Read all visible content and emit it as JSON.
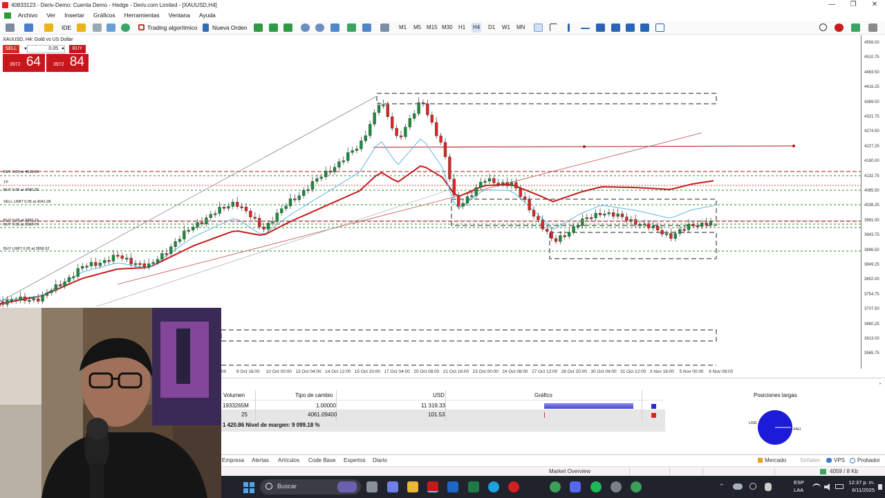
{
  "window": {
    "title": "40833123 - Deriv-Demo: Cuenta Demo - Hedge - Deriv.com Limited - [XAUUSD,H4]",
    "minimize": "—",
    "restore": "❐",
    "close": "✕"
  },
  "menu": [
    "Archivo",
    "Ver",
    "Insertar",
    "Gráficos",
    "Herramientas",
    "Ventana",
    "Ayuda"
  ],
  "toolbar": {
    "ide_label": "IDE",
    "algo_label": "Trading algorítmico",
    "new_order_label": "Nueva Orden",
    "timeframes": [
      "M1",
      "M5",
      "M15",
      "M30",
      "H1",
      "H4",
      "D1",
      "W1",
      "MN"
    ],
    "active_timeframe": "H4"
  },
  "chart": {
    "symbol_title": "XAUUSD, H4:  Gold vs US Dollar",
    "one_click": {
      "sell_label": "SELL",
      "buy_label": "BUY",
      "lot": "0.05",
      "sell_small": "3972",
      "sell_big": "64",
      "buy_small": "3972",
      "buy_big": "84"
    },
    "levels": [
      "BUY 0.05 at 4136.88",
      "TP",
      "BUY 0.05 at 4080.35",
      "SELL LIMIT 0.05 at 4041.08",
      "BUY 0.05 at 3982.15",
      "BUY 0.05 at 3968.76",
      "BUY LIMIT 0.05 at 3890.62"
    ],
    "price_axis": [
      "4556.00",
      "4510.75",
      "4463.50",
      "4416.25",
      "4369.00",
      "4321.75",
      "4274.50",
      "4227.25",
      "4180.00",
      "4132.75",
      "4085.50",
      "4038.25",
      "3991.00",
      "3943.75",
      "3896.50",
      "3849.25",
      "3802.00",
      "3754.75",
      "3707.50",
      "3660.25",
      "3613.00",
      "3565.75"
    ],
    "time_axis": [
      "8 Oct 16:00",
      "10 Oct 00:00",
      "13 Oct 04:00",
      "14 Oct 12:00",
      "15 Oct 20:00",
      "17 Oct 04:00",
      "20 Oct 08:00",
      "21 Oct 16:00",
      "23 Oct 00:00",
      "24 Oct 08:00",
      "27 Oct 12:00",
      "28 Oct 20:00",
      "30 Oct 04:00",
      "31 Oct 12:00",
      "3 Nov 16:00",
      "5 Nov 00:00",
      "6 Nov 08:00"
    ],
    "colors": {
      "bull": "#1e8a3c",
      "bear": "#d62828",
      "ma_red": "#c41a1a",
      "ma_blue": "#5bb6e6"
    }
  },
  "trade_panel": {
    "headers": [
      "Volumen",
      "Tipo de cambio",
      "USD",
      "Gráfico"
    ],
    "rows": [
      {
        "volume": "1933265M",
        "rate": "1.00000",
        "usd": "11 319.33",
        "bar": 1.0,
        "color": "#2a2ac8"
      },
      {
        "volume": "25",
        "rate": "4061.09400",
        "usd": "101.53",
        "bar": 0.01,
        "color": "#d62828"
      }
    ],
    "summary": "1 420.86  Nivel de margen: 9 099.18 %",
    "positions_title": "Posiciones largas",
    "pie_label_usd": "USD",
    "pie_label_xau": "XAU"
  },
  "terminal_tabs": [
    "Empresa",
    "Alertas",
    "Artículos",
    "Code Base",
    "Expertos",
    "Diario"
  ],
  "right_tabs": [
    "Mercado",
    "Señales",
    "VPS",
    "Probador"
  ],
  "status": {
    "market_overview": "Market Overview",
    "traffic": "4059 / 8 Kb"
  },
  "taskbar": {
    "search_placeholder": "Buscar",
    "lang": "ESP",
    "lang2": "LAA",
    "time": "12:37 p. m.",
    "date": "6/11/2025"
  }
}
